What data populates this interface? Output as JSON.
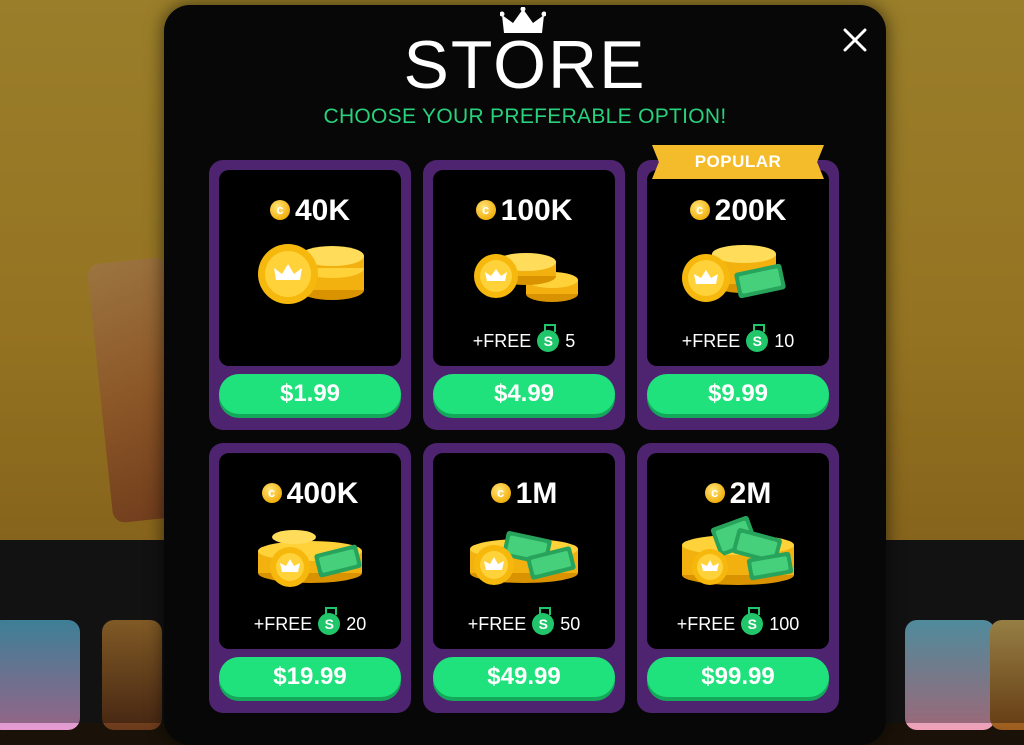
{
  "store": {
    "title": "STORE",
    "subtitle": "CHOOSE YOUR PREFERABLE OPTION!",
    "close_icon": "close-icon",
    "popular_label": "POPULAR",
    "bonus_prefix": "+FREE"
  },
  "packages": [
    {
      "amount": "40K",
      "price": "$1.99",
      "bonus": "",
      "popular": false
    },
    {
      "amount": "100K",
      "price": "$4.99",
      "bonus": "5",
      "popular": false
    },
    {
      "amount": "200K",
      "price": "$9.99",
      "bonus": "10",
      "popular": true
    },
    {
      "amount": "400K",
      "price": "$19.99",
      "bonus": "20",
      "popular": false
    },
    {
      "amount": "1M",
      "price": "$49.99",
      "bonus": "50",
      "popular": false
    },
    {
      "amount": "2M",
      "price": "$99.99",
      "bonus": "100",
      "popular": false
    }
  ],
  "colors": {
    "accent_green": "#1fe27c",
    "subtitle_green": "#28d17c",
    "card_purple": "#4e2470",
    "ribbon_gold": "#f4bc2a",
    "coin_gold": "#f2b10f"
  }
}
